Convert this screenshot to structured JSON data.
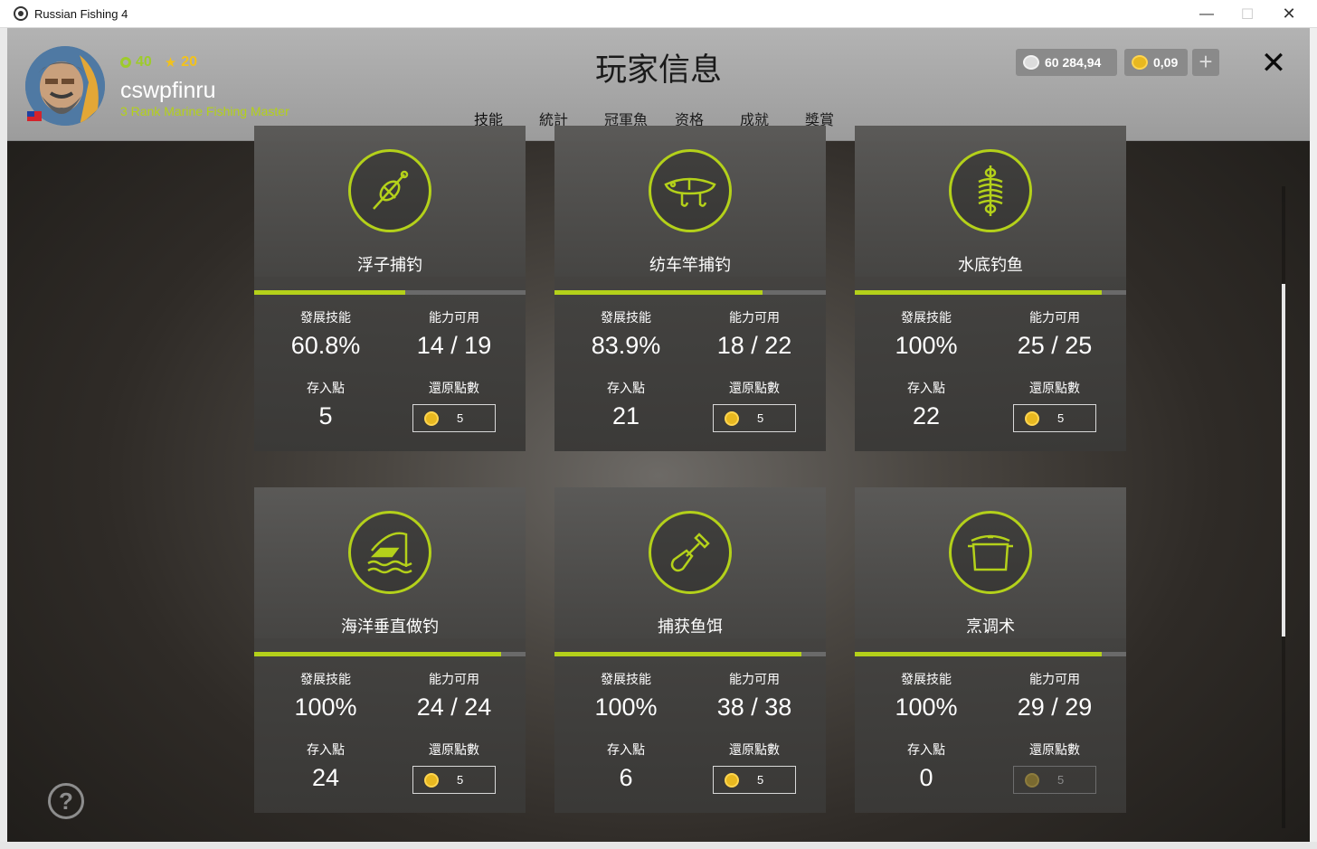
{
  "window": {
    "title": "Russian Fishing 4"
  },
  "player": {
    "level": "40",
    "rank_level": "20",
    "username": "cswpfinru",
    "rank_title": "3 Rank Marine Fishing Master"
  },
  "page_title": "玩家信息",
  "tabs": [
    {
      "label": "技能",
      "active": true
    },
    {
      "label": "統計",
      "active": false
    },
    {
      "label": "冠軍魚",
      "active": false
    },
    {
      "label": "资格",
      "active": false
    },
    {
      "label": "成就",
      "active": false
    },
    {
      "label": "獎賞",
      "active": false
    }
  ],
  "currency": {
    "silver": "60 284,94",
    "gold": "0,09"
  },
  "labels": {
    "develop": "發展技能",
    "abilities": "能力可用",
    "deposit": "存入點",
    "restore": "還原點數"
  },
  "skills": [
    {
      "name": "浮子捕钓",
      "icon": "float-icon",
      "progress": 0.558,
      "develop": "60.8%",
      "abilities": "14 / 19",
      "deposit": "5",
      "restore": "5",
      "restore_enabled": true
    },
    {
      "name": "纺车竿捕钓",
      "icon": "spinning-lure-icon",
      "progress": 0.765,
      "develop": "83.9%",
      "abilities": "18 / 22",
      "deposit": "21",
      "restore": "5",
      "restore_enabled": true
    },
    {
      "name": "水底钓鱼",
      "icon": "bottom-feeder-icon",
      "progress": 0.91,
      "develop": "100%",
      "abilities": "25 / 25",
      "deposit": "22",
      "restore": "5",
      "restore_enabled": true
    },
    {
      "name": "海洋垂直做钓",
      "icon": "marine-fishing-icon",
      "progress": 0.91,
      "develop": "100%",
      "abilities": "24 / 24",
      "deposit": "24",
      "restore": "5",
      "restore_enabled": true
    },
    {
      "name": "捕获鱼饵",
      "icon": "shovel-icon",
      "progress": 0.91,
      "develop": "100%",
      "abilities": "38 / 38",
      "deposit": "6",
      "restore": "5",
      "restore_enabled": true
    },
    {
      "name": "烹调术",
      "icon": "cooking-pot-icon",
      "progress": 0.91,
      "develop": "100%",
      "abilities": "29 / 29",
      "deposit": "0",
      "restore": "5",
      "restore_enabled": false
    }
  ],
  "help": "?"
}
